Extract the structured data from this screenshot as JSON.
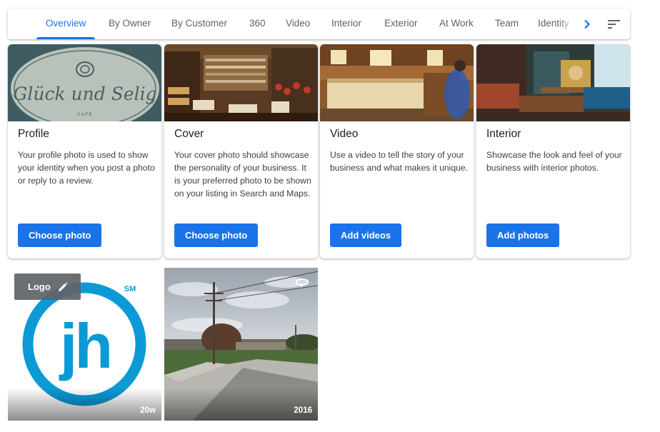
{
  "tabs": [
    {
      "label": "Overview",
      "active": true
    },
    {
      "label": "By Owner"
    },
    {
      "label": "By Customer"
    },
    {
      "label": "360"
    },
    {
      "label": "Video"
    },
    {
      "label": "Interior"
    },
    {
      "label": "Exterior"
    },
    {
      "label": "At Work"
    },
    {
      "label": "Team"
    },
    {
      "label": "Identity"
    }
  ],
  "cards": [
    {
      "title": "Profile",
      "description": "Your profile photo is used to show your identity when you post a photo or reply to a review.",
      "button": "Choose photo",
      "sign_text": "Glück und Selig",
      "sign_sub": "CAFE"
    },
    {
      "title": "Cover",
      "description": "Your cover photo should showcase the personality of your business. It is your preferred photo to be shown on your listing in Search and Maps.",
      "button": "Choose photo"
    },
    {
      "title": "Video",
      "description": "Use a video to tell the story of your business and what makes it unique.",
      "button": "Add videos"
    },
    {
      "title": "Interior",
      "description": "Showcase the look and feel of your business with interior photos.",
      "button": "Add photos"
    }
  ],
  "tiles": [
    {
      "chip_label": "Logo",
      "age": "20w",
      "logo_text": "jh",
      "logo_mark": "SM"
    },
    {
      "age": "2016"
    }
  ],
  "colors": {
    "accent": "#1a73e8",
    "logo_blue": "#0b9ad6"
  },
  "icons": {
    "next": "chevron-right-icon",
    "filter": "sort-icon",
    "edit": "pencil-icon",
    "view360": "rotate-360-icon"
  }
}
